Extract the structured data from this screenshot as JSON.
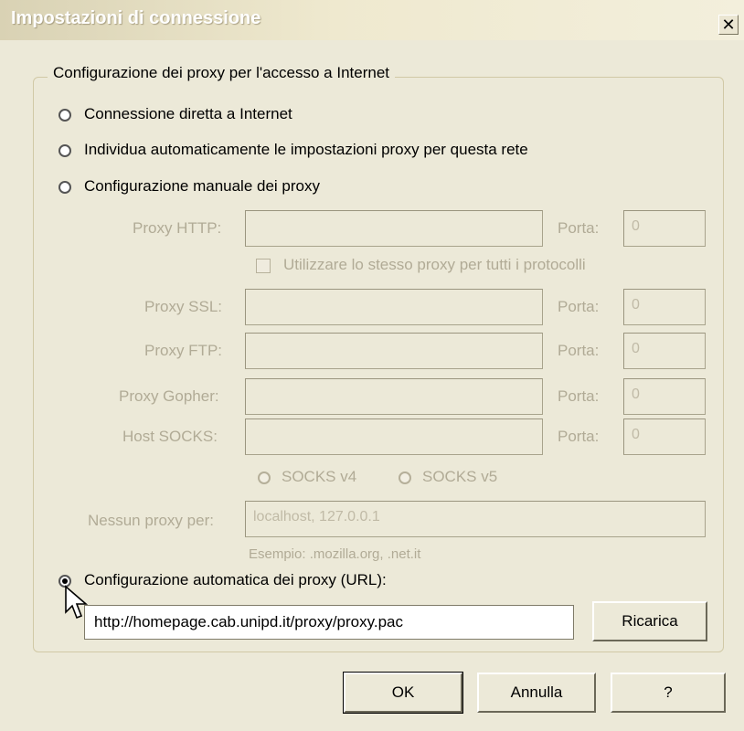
{
  "window": {
    "title": "Impostazioni di connessione",
    "close_glyph": "✕"
  },
  "group": {
    "legend": "Configurazione dei proxy per l'accesso a Internet"
  },
  "radio_options": [
    {
      "label": "Connessione diretta a Internet",
      "selected": false
    },
    {
      "label": "Individua automaticamente le impostazioni proxy per questa rete",
      "selected": false
    },
    {
      "label": "Configurazione manuale dei proxy",
      "selected": false
    },
    {
      "label": "Configurazione automatica dei proxy (URL):",
      "selected": true
    }
  ],
  "manual": {
    "http_label": "Proxy HTTP:",
    "ssl_label": "Proxy SSL:",
    "ftp_label": "Proxy FTP:",
    "gopher_label": "Proxy Gopher:",
    "socks_label": "Host SOCKS:",
    "port_label": "Porta:",
    "port_value": "0",
    "same_proxy_label": "Utilizzare lo stesso proxy per tutti i protocolli",
    "socks_v4": "SOCKS v4",
    "socks_v5": "SOCKS v5",
    "no_proxy_label": "Nessun proxy per:",
    "no_proxy_value": "localhost, 127.0.0.1",
    "example": "Esempio: .mozilla.org, .net.it"
  },
  "auto": {
    "url_value": "http://homepage.cab.unipd.it/proxy/proxy.pac",
    "reload_label": "Ricarica"
  },
  "buttons": {
    "ok": "OK",
    "cancel": "Annulla",
    "help": "?"
  }
}
